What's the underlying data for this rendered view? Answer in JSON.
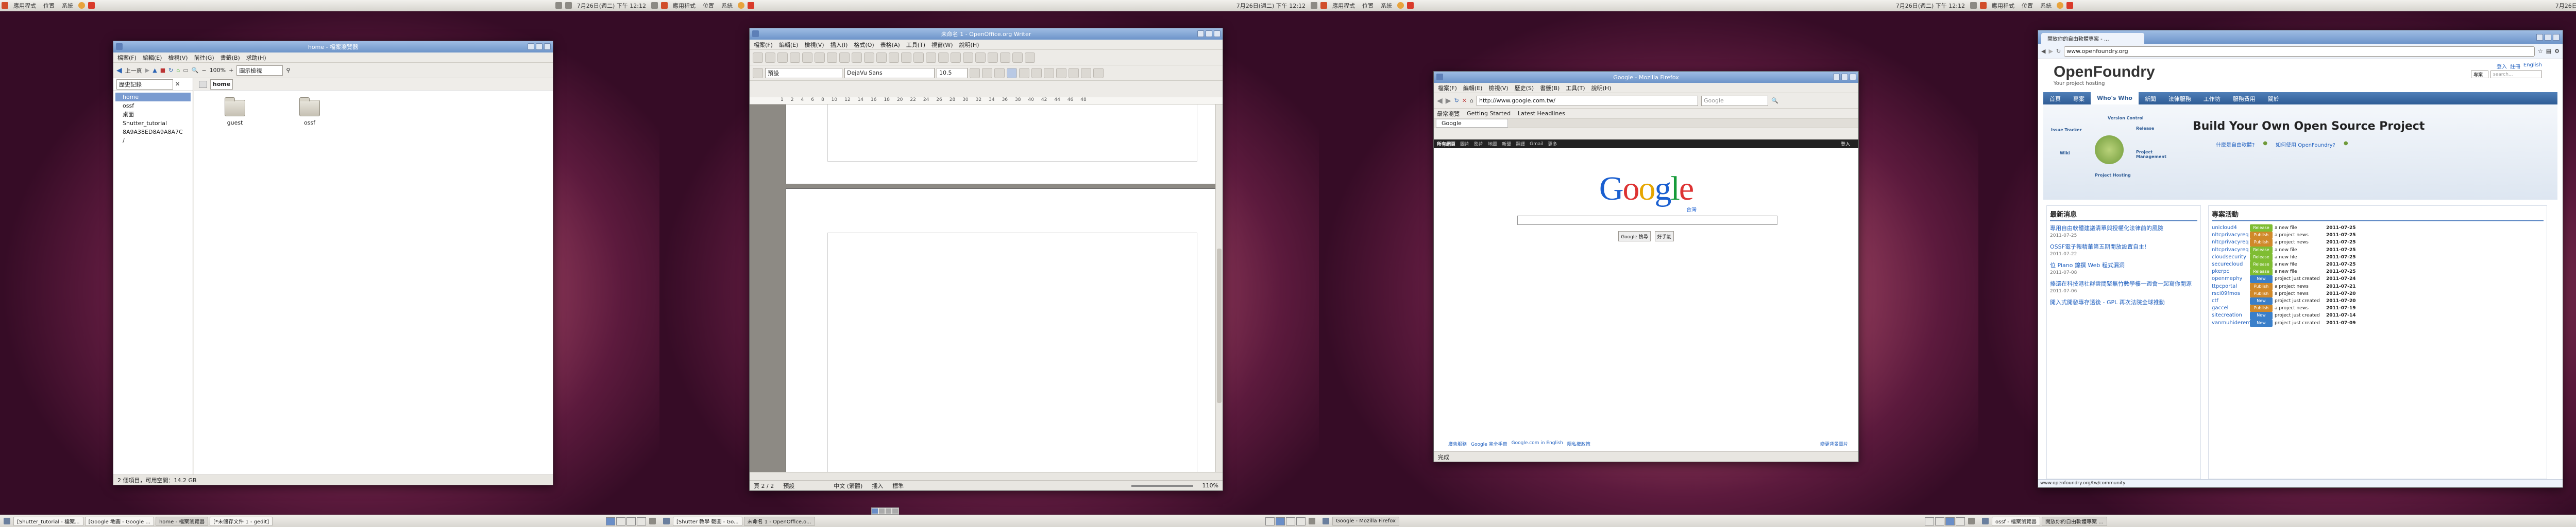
{
  "top_panel": {
    "menus": [
      "應用程式",
      "位置",
      "系統"
    ],
    "clock": "7月26日(週二) 下午 12:12"
  },
  "ws1": {
    "window_title": "home - 檔案瀏覽器",
    "menu": [
      "檔案(F)",
      "編輯(E)",
      "檢視(V)",
      "前往(G)",
      "書籤(B)",
      "求助(H)"
    ],
    "toolbar": {
      "back": "上一頁",
      "zoom": "100%",
      "view_mode": "圖示檢視"
    },
    "sidebar_header": "歷史記錄",
    "location": "home",
    "sidebar_items": [
      "home",
      "ossf",
      "桌面",
      "Shutter_tutorial",
      "8A9A38ED8A9A8A7C",
      "/"
    ],
    "files": [
      {
        "name": "guest"
      },
      {
        "name": "ossf"
      }
    ],
    "status": "2 個項目，可用空間：14.2 GB",
    "taskbar": [
      "[Shutter_tutorial - 檔案...",
      "[Google 地圖 - Google ...",
      "home - 檔案瀏覽器",
      "[*未儲存文件 1 - gedit]"
    ]
  },
  "ws2": {
    "window_title": "未命名 1 - OpenOffice.org Writer",
    "menu": [
      "檔案(F)",
      "編輯(E)",
      "檢視(V)",
      "插入(I)",
      "格式(O)",
      "表格(A)",
      "工具(T)",
      "視窗(W)",
      "說明(H)"
    ],
    "style": "預設",
    "font": "DejaVu Sans",
    "size": "10.5",
    "status_left": "頁 2 / 2",
    "status_style": "預設",
    "status_lang": "中文 (繁體)",
    "status_mode": "插入",
    "status_std": "標準",
    "zoom": "110%",
    "ruler": [
      "1",
      "2",
      "4",
      "6",
      "8",
      "10",
      "12",
      "14",
      "16",
      "18",
      "20",
      "22",
      "24",
      "26",
      "28",
      "30",
      "32",
      "34",
      "36",
      "38",
      "40",
      "42",
      "44",
      "46",
      "48"
    ],
    "taskbar": [
      "[Shutter 教學 截圖 - Go...",
      "未命名 1 - OpenOffice.o..."
    ],
    "taskbar_files": [
      "未命名 1 - OpenOffice.o..."
    ]
  },
  "ws3": {
    "window_title": "Google - Mozilla Firefox",
    "menu": [
      "檔案(F)",
      "編輯(E)",
      "檢視(V)",
      "歷史(S)",
      "書籤(B)",
      "工具(T)",
      "說明(H)"
    ],
    "url": "http://www.google.com.tw/",
    "search_engine": "Google",
    "bookmarks": [
      "最常瀏覽",
      "Getting Started",
      "Latest Headlines"
    ],
    "tab": "Google",
    "google_nav": [
      "所有網頁",
      "圖片",
      "影片",
      "地圖",
      "新聞",
      "翻譯",
      "Gmail",
      "更多"
    ],
    "login": "登入",
    "logo_sub": "台灣",
    "btn_search": "Google 搜尋",
    "btn_lucky": "好手氣",
    "footer": [
      "廣告服務",
      "Google 完全手冊",
      "Google.com in English",
      "隱私權政策"
    ],
    "footer_right": "變更背景圖片",
    "status": "完成",
    "taskbar": [
      "Google - Mozilla Firefox"
    ]
  },
  "ws4": {
    "window_title": "開放你的自由軟體專案 - ...",
    "url": "www.openfoundry.org",
    "header_links": [
      "登入",
      "註冊",
      "English"
    ],
    "search_scope": "專案",
    "search_placeholder": "search...",
    "logo": "OpenFoundry",
    "tagline": "Your project hosting",
    "nav": [
      "首頁",
      "專案",
      "Who's Who",
      "新聞",
      "法律服務",
      "工作坊",
      "服務費用",
      "關於"
    ],
    "hero_title": "Build Your Own Open Source Project",
    "hero_btn1": "什麼是自由軟體?",
    "hero_btn2": "如何使用 OpenFoundry?",
    "diagram_labels": [
      "Version Control",
      "Issue Tracker",
      "Release",
      "Wiki",
      "Project Management",
      "Project Hosting"
    ],
    "news_title": "最新消息",
    "news": [
      {
        "title": "專用自由軟體建議清單與授權化法律前的風險",
        "date": "2011-07-25"
      },
      {
        "title": "OSSF電子報精華第五期開放設置自主!",
        "date": "2011-07-22"
      },
      {
        "title": "位 Piano 錦撰 Web 程式漏洞",
        "date": "2011-07-08"
      },
      {
        "title": "捧還在科技港社群雲間緊無竹數學樓一週會一起寫你開源",
        "date": "2011-07-06"
      },
      {
        "title": "開入式開發專存透後 - GPL 再次法院全球推動",
        "date": ""
      }
    ],
    "activity_title": "專案活動",
    "activity": [
      {
        "project": "unicloud4",
        "tag": "Release",
        "what": "a new file",
        "date": "2011-07-25"
      },
      {
        "project": "nltcprivacyreq",
        "tag": "Publish",
        "what": "a project news",
        "date": "2011-07-25"
      },
      {
        "project": "nltcprivacyreq",
        "tag": "Publish",
        "what": "a project news",
        "date": "2011-07-25"
      },
      {
        "project": "nltcprivacyreq",
        "tag": "Release",
        "what": "a new file",
        "date": "2011-07-25"
      },
      {
        "project": "cloudsecurity",
        "tag": "Release",
        "what": "a new file",
        "date": "2011-07-25"
      },
      {
        "project": "securecloud",
        "tag": "Release",
        "what": "a new file",
        "date": "2011-07-25"
      },
      {
        "project": "pkerpc",
        "tag": "Release",
        "what": "a new file",
        "date": "2011-07-25"
      },
      {
        "project": "openmephy",
        "tag": "New",
        "what": "project just created",
        "date": "2011-07-24"
      },
      {
        "project": "ttpcportal",
        "tag": "Publish",
        "what": "a project news",
        "date": "2011-07-21"
      },
      {
        "project": "rsci09fmos",
        "tag": "Publish",
        "what": "a project news",
        "date": "2011-07-20"
      },
      {
        "project": "ctf",
        "tag": "New",
        "what": "project just created",
        "date": "2011-07-20"
      },
      {
        "project": "gaccel",
        "tag": "Publish",
        "what": "a project news",
        "date": "2011-07-19"
      },
      {
        "project": "sitecreation",
        "tag": "New",
        "what": "project just created",
        "date": "2011-07-14"
      },
      {
        "project": "vanmuhiderem",
        "tag": "New",
        "what": "project just created",
        "date": "2011-07-09"
      }
    ],
    "status_url": "www.openfoundry.org/tw/community",
    "taskbar": [
      "ossf - 檔案瀏覽器",
      "開放你的自由軟體專案 ..."
    ]
  },
  "colors": {
    "title_active": "#7a9bd0",
    "tag_release": "#7fbd32",
    "tag_publish": "#d0892a",
    "tag_new": "#3a7fc9"
  }
}
